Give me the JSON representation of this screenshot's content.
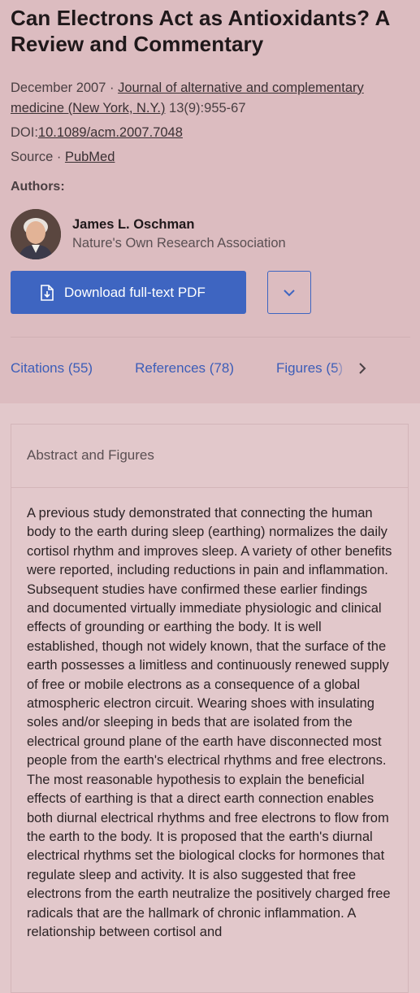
{
  "article": {
    "title": "Can Electrons Act as Antioxidants? A Review and Commentary",
    "date": "December 2007 · ",
    "journal": "Journal of alternative and complementary medicine (New York, N.Y.)",
    "citation": " 13(9):955-67",
    "doi_label": "DOI:",
    "doi": "10.1089/acm.2007.7048",
    "source_label": "Source · ",
    "source": "PubMed"
  },
  "authors": {
    "label": "Authors:",
    "list": [
      {
        "name": "James L. Oschman",
        "affiliation": "Nature's Own Research Association"
      }
    ]
  },
  "actions": {
    "download_label": "Download full-text PDF"
  },
  "tabs": [
    {
      "label": "Citations (55)"
    },
    {
      "label": "References (78)"
    },
    {
      "label": "Figures (5)"
    }
  ],
  "abstract": {
    "heading": "Abstract and Figures",
    "text": "A previous study demonstrated that connecting the human body to the earth during sleep (earthing) normalizes the daily cortisol rhythm and improves sleep. A variety of other benefits were reported, including reductions in pain and inflammation. Subsequent studies have confirmed these earlier findings and documented virtually immediate physiologic and clinical effects of grounding or earthing the body. It is well established, though not widely known, that the surface of the earth possesses a limitless and continuously renewed supply of free or mobile electrons as a consequence of a global atmospheric electron circuit. Wearing shoes with insulating soles and/or sleeping in beds that are isolated from the electrical ground plane of the earth have disconnected most people from the earth's electrical rhythms and free electrons. The most reasonable hypothesis to explain the beneficial effects of earthing is that a direct earth connection enables both diurnal electrical rhythms and free electrons to flow from the earth to the body. It is proposed that the earth's diurnal electrical rhythms set the biological clocks for hormones that regulate sleep and activity. It is also suggested that free electrons from the earth neutralize the positively charged free radicals that are the hallmark of chronic inflammation. A relationship between cortisol and"
  },
  "colors": {
    "accent": "#3e65c1",
    "background": "#e2c8cb"
  }
}
